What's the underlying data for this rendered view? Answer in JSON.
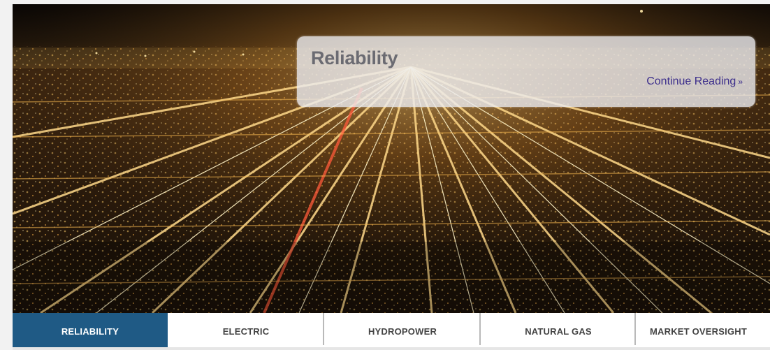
{
  "hero": {
    "image_label": "city-lights-aerial-photo",
    "caption": {
      "title": "Reliability",
      "link_text": "Continue Reading",
      "link_suffix": "»"
    }
  },
  "tabs": [
    {
      "label": "RELIABILITY",
      "active": true
    },
    {
      "label": "ELECTRIC",
      "active": false
    },
    {
      "label": "HYDROPOWER",
      "active": false
    },
    {
      "label": "NATURAL GAS",
      "active": false
    },
    {
      "label": "MARKET OVERSIGHT",
      "active": false
    }
  ],
  "colors": {
    "active_tab": "#1f5a85",
    "link": "#3d2f8c",
    "title": "#6b6b72"
  }
}
